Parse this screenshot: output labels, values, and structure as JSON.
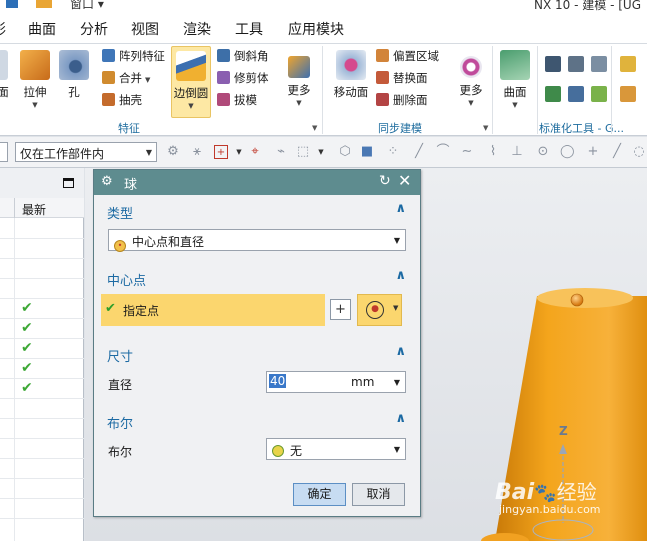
{
  "window": {
    "app_title": "NX 10 - 建模 - [UG",
    "window_menu": "窗口 ▾"
  },
  "menubar": {
    "items": [
      "形",
      "曲面",
      "分析",
      "视图",
      "渲染",
      "工具",
      "应用模块"
    ]
  },
  "ribbon": {
    "left_fragment": "面",
    "feature_group": {
      "label": "特征",
      "extrude_label": "拉伸",
      "hole_label": "孔",
      "pattern_label": "阵列特征",
      "unite_label": "合并",
      "shell_label": "抽壳",
      "edge_blend_label": "边倒圆",
      "chamfer_label": "倒斜角",
      "trim_body_label": "修剪体",
      "draft_label": "拔模",
      "more_label": "更多"
    },
    "sync_group": {
      "label": "同步建模",
      "move_face_label": "移动面",
      "offset_region_label": "偏置区域",
      "replace_face_label": "替换面",
      "delete_face_label": "删除面",
      "more_label": "更多"
    },
    "surface_group": {
      "surface_label": "曲面",
      "label": "标准化工具 - G..."
    }
  },
  "selection_toolbar": {
    "type_filter": "",
    "scope_filter": "仅在工作部件内"
  },
  "navigator": {
    "column_header": "最新",
    "checked_rows": 5
  },
  "dialog": {
    "title": "球",
    "sections": {
      "type": {
        "title": "类型",
        "value": "中心点和直径"
      },
      "center": {
        "title": "中心点",
        "specify_point_label": "指定点"
      },
      "dimensions": {
        "title": "尺寸",
        "diameter_label": "直径",
        "diameter_value": "40",
        "unit": "mm"
      },
      "boolean": {
        "title": "布尔",
        "label": "布尔",
        "value": "无"
      }
    },
    "ok_label": "确定",
    "cancel_label": "取消"
  },
  "graphics": {
    "axis_label": "Z"
  },
  "watermark": {
    "brand": "Bai",
    "brand_suffix": "经验",
    "url": "jingyan.baidu.com"
  },
  "colors": {
    "dialog_title_bar": "#5e8c8f",
    "section_title": "#1c6aa3",
    "selected_row": "#fbd66e",
    "part_orange": "#f4a51c",
    "check_green": "#3ca835",
    "primary_button": "#c7dcf2"
  }
}
